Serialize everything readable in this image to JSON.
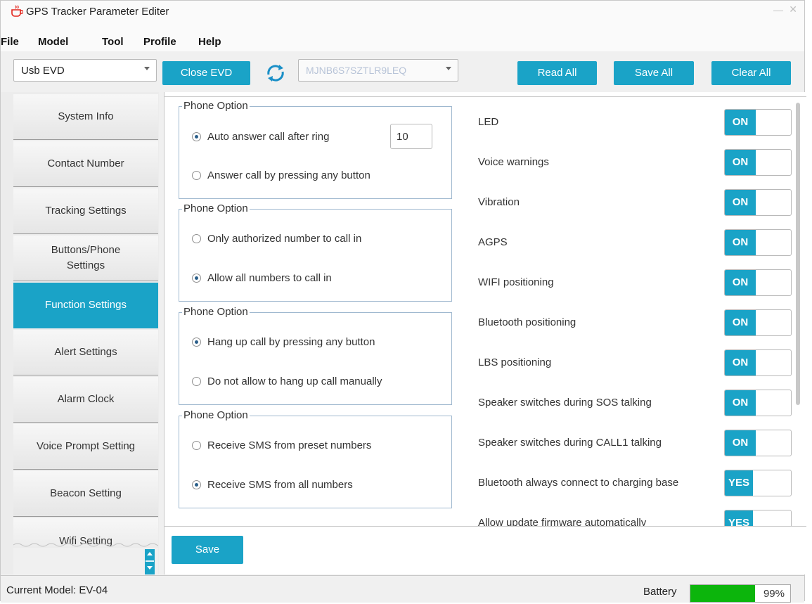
{
  "window": {
    "title": "GPS Tracker Parameter Editer"
  },
  "menu": [
    "File",
    "Model",
    "Tool",
    "Profile",
    "Help"
  ],
  "toolbar": {
    "connection": "Usb EVD",
    "close_label": "Close EVD",
    "device_id": "MJNB6S7SZTLR9LEQ",
    "read_all": "Read All",
    "save_all": "Save All",
    "clear_all": "Clear All"
  },
  "sidebar": {
    "items": [
      "System Info",
      "Contact Number",
      "Tracking Settings",
      "Buttons/Phone Settings",
      "Function Settings",
      "Alert Settings",
      "Alarm Clock",
      "Voice Prompt Setting",
      "Beacon Setting",
      "Wifi Setting"
    ],
    "active_index": 4
  },
  "groups": [
    {
      "legend": "Phone Option",
      "options": [
        {
          "label": "Auto answer call after ring",
          "checked": true
        },
        {
          "label": "Answer call by pressing any button",
          "checked": false
        }
      ],
      "ring_count": "10"
    },
    {
      "legend": "Phone Option",
      "options": [
        {
          "label": "Only authorized number to call in",
          "checked": false
        },
        {
          "label": "Allow all numbers to call in",
          "checked": true
        }
      ]
    },
    {
      "legend": "Phone Option",
      "options": [
        {
          "label": "Hang up call by pressing any button",
          "checked": true
        },
        {
          "label": "Do not allow to hang up call manually",
          "checked": false
        }
      ]
    },
    {
      "legend": "Phone Option",
      "options": [
        {
          "label": "Receive SMS from preset numbers",
          "checked": false
        },
        {
          "label": "Receive SMS from all numbers",
          "checked": true
        }
      ]
    }
  ],
  "toggles": [
    {
      "label": "LED",
      "state": "ON"
    },
    {
      "label": "Voice warnings",
      "state": "ON"
    },
    {
      "label": "Vibration",
      "state": "ON"
    },
    {
      "label": "AGPS",
      "state": "ON"
    },
    {
      "label": "WIFI positioning",
      "state": "ON"
    },
    {
      "label": "Bluetooth positioning",
      "state": "ON"
    },
    {
      "label": "LBS positioning",
      "state": "ON"
    },
    {
      "label": "Speaker switches during SOS talking",
      "state": "ON"
    },
    {
      "label": "Speaker switches during CALL1 talking",
      "state": "ON"
    },
    {
      "label": "Bluetooth always connect to charging base",
      "state": "YES"
    },
    {
      "label": "Allow update firmware automatically",
      "state": "YES"
    }
  ],
  "save_label": "Save",
  "status": {
    "model": "Current Model: EV-04",
    "battery_label": "Battery",
    "battery_percent": "99%",
    "battery_level": 0.65
  },
  "colors": {
    "accent": "#1aa3c7",
    "battery": "#0cb50c"
  }
}
